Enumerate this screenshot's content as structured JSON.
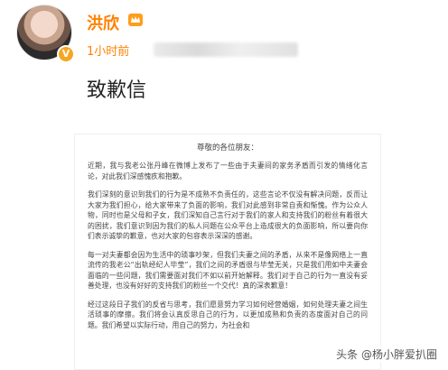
{
  "author": {
    "name": "洪欣",
    "verified_symbol": "V"
  },
  "post": {
    "time": "1小时前",
    "title": "致歉信"
  },
  "letter": {
    "greeting": "尊敬的各位朋友：",
    "paragraphs": [
      "近期，我与我老公张丹峰在微博上发布了一些由于夫妻间的家务矛盾而引发的情绪化言论，对此我们深感愧疚和抱歉。",
      "我们深刻的意识到我们的行为是不成熟不负责任的，这些言论不仅没有解决问题，反而让大家为我们担心，给大家带来了负面的影响，我们对此感到非常自责和惭愧。作为公众人物，同时也是父母和子女，我们深知自己言行对于我们的家人和支持我们的粉丝有着很大的困扰，我们意识到因为我们的私人问题在公众平台上造成很大的负面影响，所以要向你们表示诚挚的歉意，也对大家的包容表示深深的感谢。",
      "每一对夫妻都会因为生活中的琐事吵架，但我们夫妻之间的矛盾，从来不是像网络上一直流传的我老公“出轨经纪人毕莹”，我们之间的矛盾很与毕莹无关，只是我们用如中夫妻会面临的一些问题，我们需要面对我们不如以前开始解释。我们对于自己的行为一直没有妥善处理，也没有好好的支持我们的粉丝一个交代！真的深表歉意！",
      "经过这段日子我们的反省与思考，我们愿意努力学习如何经营婚姻，如何处理夫妻之间生活琐事的摩擦。我们将会认真反思自己的行为，以更加成熟和负责的态度面对自己的问题。我们希望以实际行动，用自己的努力，为社会和"
    ]
  },
  "watermark": "头条 @杨小胖爱扒圈"
}
